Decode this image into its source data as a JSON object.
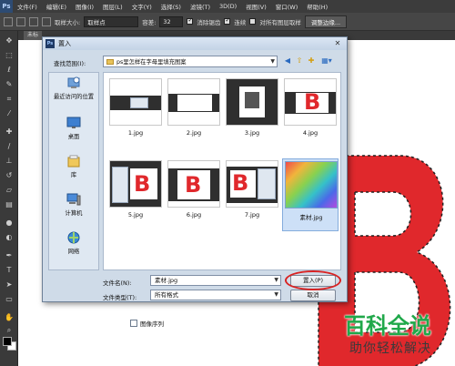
{
  "app": {
    "logo": "Ps",
    "menu": [
      "文件(F)",
      "编辑(E)",
      "图像(I)",
      "图层(L)",
      "文字(Y)",
      "选择(S)",
      "滤镜(T)",
      "3D(D)",
      "视图(V)",
      "窗口(W)",
      "帮助(H)"
    ]
  },
  "options_bar": {
    "sample_size_label": "取样大小:",
    "sample_size_value": "取样点",
    "tolerance_label": "容差:",
    "tolerance_value": "32",
    "antialias_label": "消除锯齿",
    "contiguous_label": "连续",
    "all_layers_label": "对所有图层取样",
    "refine_edge_label": "调整边缘..."
  },
  "document": {
    "tab_label": "未标"
  },
  "dialog": {
    "title": "置入",
    "close_glyph": "✕",
    "look_in_label": "查找范围(I):",
    "look_in_value": "ps里怎样在字母里填充图案",
    "places": [
      {
        "label": "最近访问的位置",
        "icon": "recent-places-icon"
      },
      {
        "label": "桌面",
        "icon": "desktop-icon"
      },
      {
        "label": "库",
        "icon": "libraries-icon"
      },
      {
        "label": "计算机",
        "icon": "computer-icon"
      },
      {
        "label": "网络",
        "icon": "network-icon"
      }
    ],
    "files": [
      {
        "name": "1.jpg"
      },
      {
        "name": "2.jpg"
      },
      {
        "name": "3.jpg"
      },
      {
        "name": "4.jpg"
      },
      {
        "name": "5.jpg"
      },
      {
        "name": "6.jpg"
      },
      {
        "name": "7.jpg"
      },
      {
        "name": "素材.jpg",
        "selected": true
      }
    ],
    "thumb_letter": "B",
    "file_name_label": "文件名(N):",
    "file_name_value": "素材.jpg",
    "file_type_label": "文件类型(T):",
    "file_type_value": "所有格式",
    "open_button": "置入(P)",
    "cancel_button": "取消",
    "image_sequence_label": "图像序列"
  },
  "watermark": {
    "title": "百科全说",
    "subtitle": "助你轻松解决"
  },
  "colors": {
    "accent_red": "#e0282c",
    "watermark_green": "#20a84a"
  }
}
